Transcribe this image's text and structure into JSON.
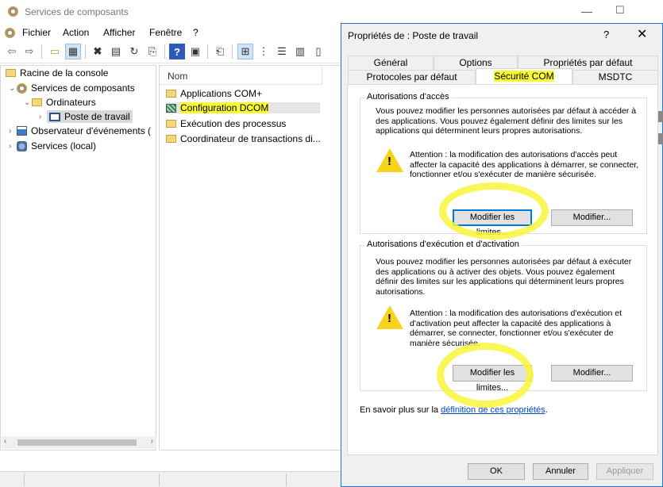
{
  "window": {
    "title": "Services de composants"
  },
  "menu": [
    "Fichier",
    "Action",
    "Afficher",
    "Fenêtre",
    "?"
  ],
  "toolbar": {
    "icons": [
      "back-icon",
      "forward-icon",
      "up-folder-icon",
      "show-hide-tree-icon",
      "delete-icon",
      "properties-icon",
      "refresh-icon",
      "export-list-icon",
      "help-icon",
      "console-icon",
      "new-window-icon",
      "large-icons-view-icon",
      "small-icons-view-icon",
      "list-view-icon",
      "details-view-icon"
    ]
  },
  "tree": {
    "root": "Racine de la console",
    "component_services": "Services de composants",
    "computers": "Ordinateurs",
    "my_computer": "Poste de travail",
    "event_viewer": "Observateur d'événements (",
    "local_services": "Services (local)"
  },
  "list": {
    "header": "Nom",
    "items": [
      "Applications COM+",
      "Configuration DCOM",
      "Exécution des processus",
      "Coordinateur de transactions di..."
    ]
  },
  "dialog": {
    "title": "Propriétés de : Poste de travail",
    "help": "?",
    "close": "✕",
    "tabs_back": [
      "Général",
      "Options",
      "Propriétés par défaut"
    ],
    "tabs_front": [
      "Protocoles par défaut",
      "Sécurité COM",
      "MSDTC"
    ],
    "access": {
      "label": "Autorisations d'accès",
      "text": "Vous pouvez modifier les personnes autorisées par défaut à accéder à des applications. Vous pouvez également définir des limites sur les applications qui déterminent leurs propres autorisations.",
      "warning": "Attention : la modification des autorisations d'accès peut affecter la capacité des applications à démarrer, se connecter, fonctionner et/ou s'exécuter de manière sécurisée.",
      "limits_button": "Modifier les limites...",
      "edit_button": "Modifier..."
    },
    "launch": {
      "label": "Autorisations d'exécution et d'activation",
      "text": "Vous pouvez modifier les personnes autorisées par défaut à exécuter des applications ou à activer des objets. Vous pouvez également définir des limites sur les applications qui déterminent leurs propres autorisations.",
      "warning": "Attention : la modification des autorisations d'exécution et d'activation peut affecter la capacité des applications à démarrer, se connecter, fonctionner et/ou s'exécuter de manière sécurisée.",
      "limits_button": "Modifier les limites...",
      "edit_button": "Modifier..."
    },
    "learn_more_prefix": "En savoir plus sur la ",
    "learn_more_link": "définition de ces propriétés",
    "learn_more_suffix": ".",
    "ok": "OK",
    "cancel": "Annuler",
    "apply": "Appliquer"
  },
  "colors": {
    "highlight": "#fafa33",
    "accent": "#1a78d7",
    "link": "#0046c8"
  }
}
